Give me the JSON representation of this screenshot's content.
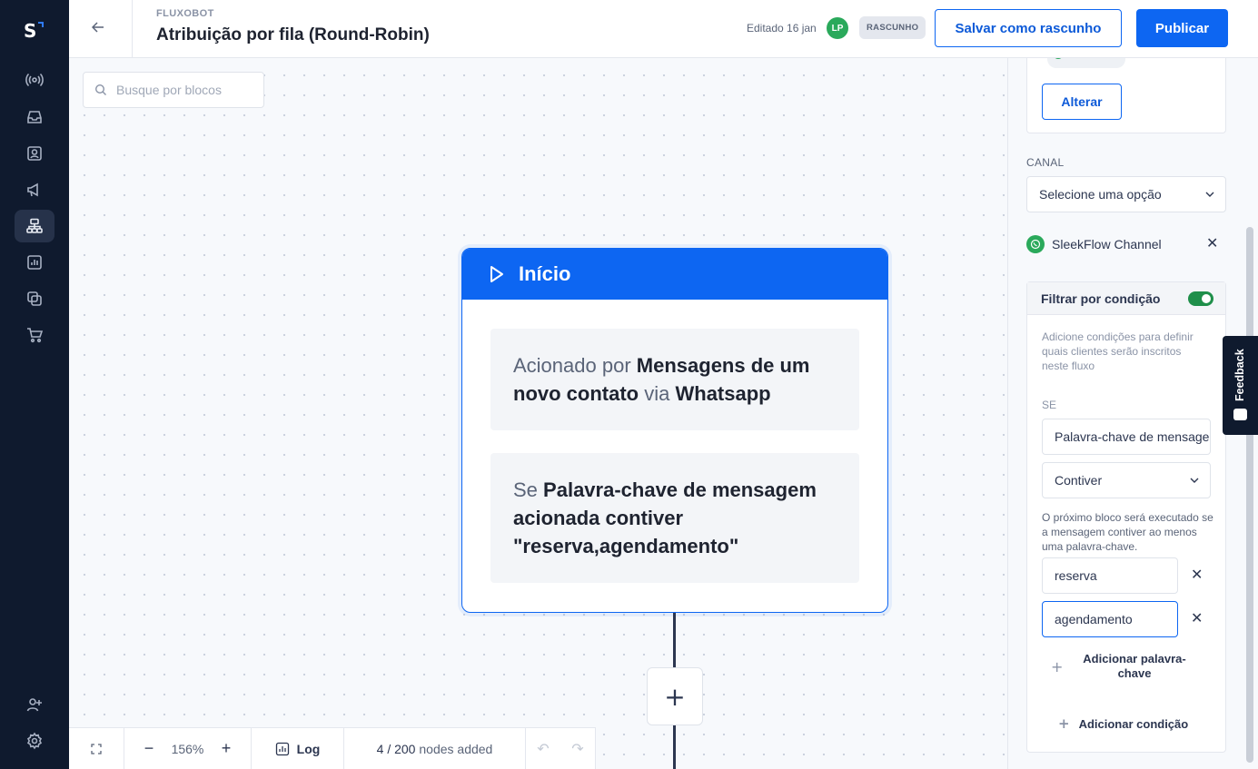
{
  "header": {
    "eyebrow": "FLUXOBOT",
    "title": "Atribuição por fila (Round-Robin)",
    "edited": "Editado 16 jan",
    "avatar_initials": "LP",
    "status_badge": "RASCUNHO",
    "save_draft_label": "Salvar como rascunho",
    "publish_label": "Publicar"
  },
  "nav": {
    "items": [
      "broadcast-icon",
      "inbox-icon",
      "contacts-icon",
      "campaigns-icon",
      "flow-builder-icon",
      "analytics-icon",
      "integrations-icon",
      "commerce-icon",
      "add-user-icon",
      "settings-icon"
    ],
    "active": "flow-builder-icon",
    "logo": "S"
  },
  "canvas": {
    "search_placeholder": "Busque por blocos",
    "start_node": {
      "title": "Início",
      "trigger": {
        "prefix": "Acionado por",
        "event": "Mensagens de um novo contato",
        "via": "via",
        "channel": "Whatsapp"
      },
      "condition": {
        "prefix": "Se",
        "text": "Palavra-chave de mensagem acionada contiver \"reserva,agendamento\""
      }
    },
    "add_block_label": "+"
  },
  "bottom_bar": {
    "zoom_out": "−",
    "zoom": "156%",
    "zoom_in": "+",
    "log_label": "Log",
    "nodes_count": "4 / 200",
    "nodes_suffix": "nodes added",
    "undo": "↶",
    "redo": "↷"
  },
  "panel": {
    "change_button": "Alterar",
    "channel_label": "CANAL",
    "channel_select_placeholder": "Selecione uma opção",
    "channel_selected": "SleekFlow Channel",
    "filter": {
      "title": "Filtrar por condição",
      "enabled": true,
      "help": "Adicione condições para definir quais clientes serão inscritos neste fluxo",
      "if_label": "SE",
      "field_value": "Palavra-chave de mensagem",
      "operator_value": "Contiver",
      "operator_help": "O próximo bloco será executado se a mensagem contiver ao menos uma palavra-chave.",
      "keywords": [
        "reserva",
        "agendamento"
      ],
      "add_keyword_label": "Adicionar palavra-chave",
      "add_condition_label": "Adicionar condição"
    }
  },
  "feedback_label": "Feedback",
  "colors": {
    "primary": "#0d66f2",
    "nav_bg": "#0f1a2e",
    "success": "#2aa95b"
  }
}
